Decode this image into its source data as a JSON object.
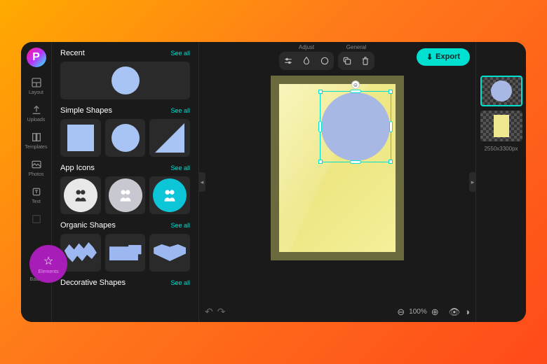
{
  "leftbar": {
    "items": [
      {
        "label": "Layout"
      },
      {
        "label": "Uploads"
      },
      {
        "label": "Templates"
      },
      {
        "label": "Photos"
      },
      {
        "label": "Text"
      },
      {
        "label": "Elements"
      },
      {
        "label": "Batch"
      }
    ]
  },
  "panel": {
    "sections": [
      {
        "title": "Recent",
        "see_all": "See all"
      },
      {
        "title": "Simple Shapes",
        "see_all": "See all"
      },
      {
        "title": "App Icons",
        "see_all": "See all"
      },
      {
        "title": "Organic Shapes",
        "see_all": "See all"
      },
      {
        "title": "Decorative Shapes",
        "see_all": "See all"
      }
    ]
  },
  "topbar": {
    "adjust_label": "Adjust",
    "general_label": "General",
    "export_label": "Export"
  },
  "canvas": {
    "dimensions": "2550x3300px",
    "zoom": "100%"
  }
}
